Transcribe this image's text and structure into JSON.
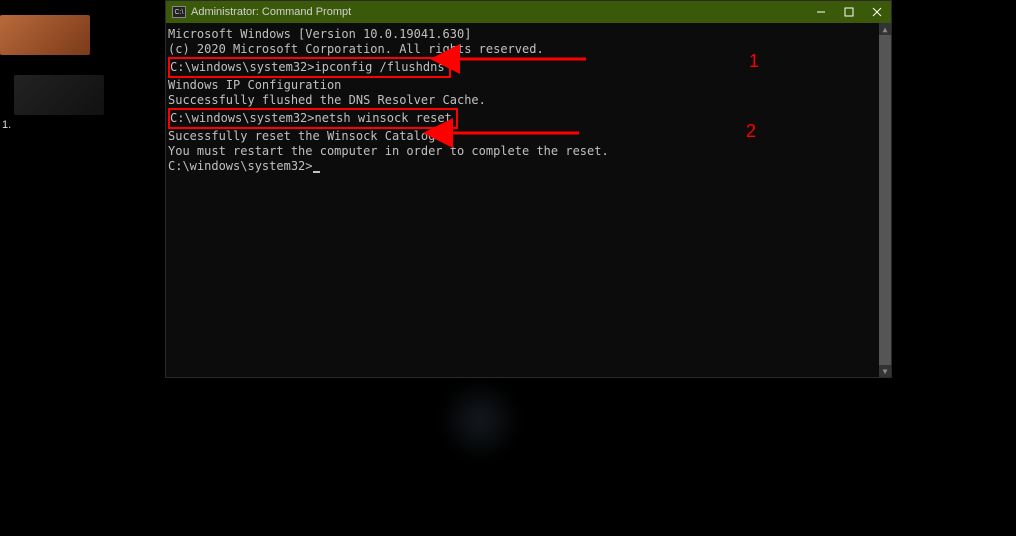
{
  "titlebar": {
    "title": "Administrator: Command Prompt",
    "icon_glyph": "C:\\"
  },
  "side": {
    "item2_num": "1."
  },
  "terminal": {
    "l1": "Microsoft Windows [Version 10.0.19041.630]",
    "l2": "(c) 2020 Microsoft Corporation. All rights reserved.",
    "blank1": "",
    "cmd1_prompt": "C:\\windows\\system32>",
    "cmd1_input": "ipconfig /flushdns",
    "blank2": "",
    "l5": "Windows IP Configuration",
    "blank3": "",
    "l6": "Successfully flushed the DNS Resolver Cache.",
    "blank4": "",
    "cmd2_prompt": "C:\\windows\\system32>",
    "cmd2_input": "netsh winsock reset",
    "blank5": "",
    "l8": "Sucessfully reset the Winsock Catalog.",
    "l9": "You must restart the computer in order to complete the reset.",
    "blank6": "",
    "blank7": "",
    "cmd3_prompt": "C:\\windows\\system32>"
  },
  "annotations": {
    "n1": "1",
    "n2": "2"
  }
}
